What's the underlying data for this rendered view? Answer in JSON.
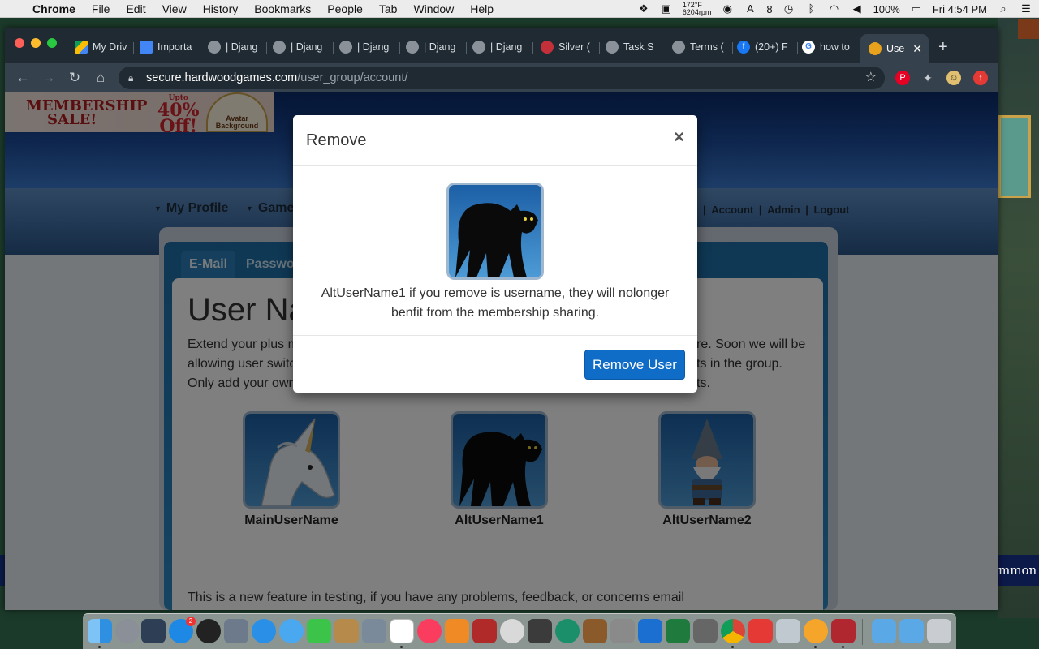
{
  "menubar": {
    "app": "Chrome",
    "items": [
      "File",
      "Edit",
      "View",
      "History",
      "Bookmarks",
      "People",
      "Tab",
      "Window",
      "Help"
    ],
    "temp": "172°F",
    "rpm": "6204rpm",
    "notif_count": "8",
    "battery": "100%",
    "clock": "Fri 4:54 PM"
  },
  "desktop": {
    "banner_text": "mmon"
  },
  "browser": {
    "tabs": [
      {
        "label": "My Driv",
        "icon": "google-drive-icon"
      },
      {
        "label": "Importa",
        "icon": "google-docs-icon"
      },
      {
        "label": "| Djang",
        "icon": "globe-icon"
      },
      {
        "label": "| Djang",
        "icon": "globe-icon"
      },
      {
        "label": "| Djang",
        "icon": "globe-icon"
      },
      {
        "label": "| Djang",
        "icon": "globe-icon"
      },
      {
        "label": "| Djang",
        "icon": "globe-icon"
      },
      {
        "label": "Silver (",
        "icon": "silver-icon"
      },
      {
        "label": "Task S",
        "icon": "globe-icon"
      },
      {
        "label": "Terms (",
        "icon": "globe-icon"
      },
      {
        "label": "(20+) F",
        "icon": "facebook-icon"
      },
      {
        "label": "how to",
        "icon": "google-icon"
      }
    ],
    "active_tab": {
      "label": "Use",
      "icon": "hardwood-icon"
    },
    "url_host": "secure.hardwoodgames.com",
    "url_path": "/user_group/account/"
  },
  "site": {
    "sale_line1": "MEMBERSHIP",
    "sale_line2": "SALE!",
    "sale_upto": "Upto",
    "sale_pct": "40%",
    "sale_off": "Off!",
    "sale_badge_l1": "Avatar",
    "sale_badge_l2": "Background",
    "nav": [
      "My Profile",
      "Game"
    ],
    "top_links": [
      "Account",
      "Admin",
      "Logout"
    ],
    "tabs": [
      "E-Mail",
      "Passwo"
    ],
    "page_title": "User Na",
    "intro_lines": [
      "Extend your plus m",
      "allowing user switc",
      "Only add your own"
    ],
    "intro_right_lines": [
      "re. Soon we will be",
      "ts in the group.",
      "ts."
    ],
    "users": [
      {
        "name": "MainUserName",
        "avatar": "unicorn-avatar"
      },
      {
        "name": "AltUserName1",
        "avatar": "black-cat-avatar"
      },
      {
        "name": "AltUserName2",
        "avatar": "gnome-avatar"
      }
    ],
    "footer_note": "This is a new feature in testing, if you have any problems, feedback, or concerns email"
  },
  "modal": {
    "title": "Remove",
    "close": "×",
    "avatar": "black-cat-avatar",
    "message": "AltUserName1 if you remove is username, they will nolonger benfit from the membership sharing.",
    "button": "Remove User"
  },
  "colors": {
    "primary_button": "#0f6cc7",
    "panel_blue": "#1e6fa8",
    "tabstrip": "#1f2a33",
    "toolbar": "#35414c"
  }
}
